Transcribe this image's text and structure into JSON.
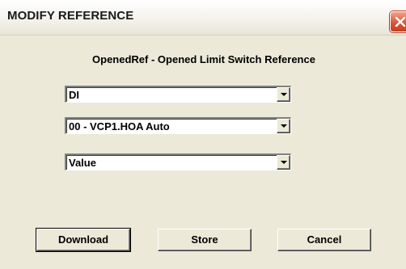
{
  "window": {
    "title": "MODIFY REFERENCE",
    "close_icon": "close-icon"
  },
  "heading": "OpenedRef - Opened Limit Switch Reference",
  "combos": [
    {
      "value": "DI"
    },
    {
      "value": "00 - VCP1.HOA Auto"
    },
    {
      "value": "Value"
    }
  ],
  "buttons": {
    "download": "Download",
    "store": "Store",
    "cancel": "Cancel"
  },
  "colors": {
    "dialog_bg": "#ece9d8",
    "close_red": "#d8573a"
  }
}
